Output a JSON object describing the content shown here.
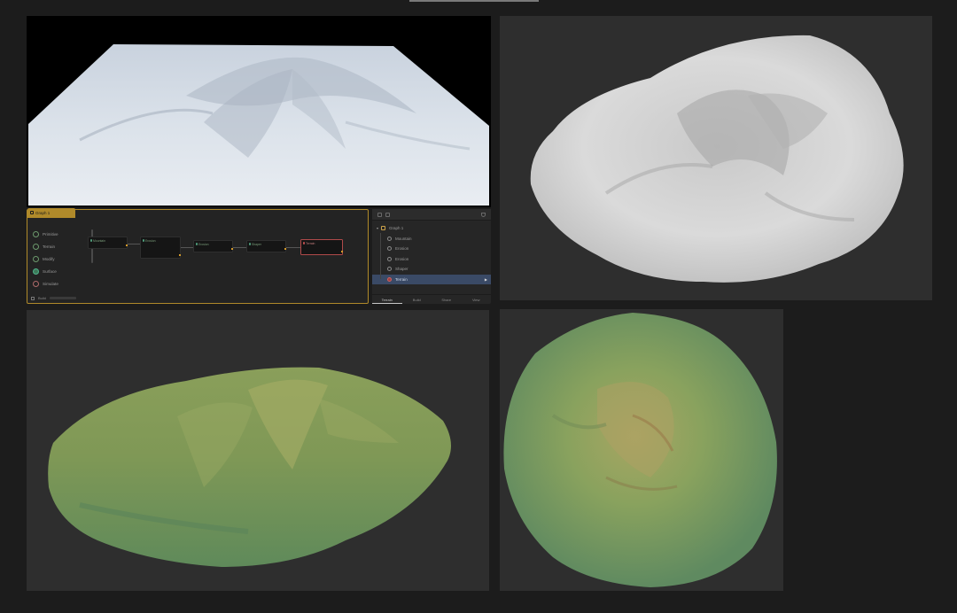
{
  "graph": {
    "tab_title": "Graph 1",
    "toolbox": [
      {
        "label": "Primitive",
        "icon": "primitive-icon"
      },
      {
        "label": "Terrain",
        "icon": "terrain-icon"
      },
      {
        "label": "Modify",
        "icon": "modify-icon"
      },
      {
        "label": "Surface",
        "icon": "surface-icon"
      },
      {
        "label": "Simulate",
        "icon": "simulate-icon"
      }
    ],
    "footer_label": "Build",
    "nodes": [
      {
        "title": "Mountain"
      },
      {
        "title": "Erosion"
      },
      {
        "title": "Erosion"
      },
      {
        "title": "Shaper"
      },
      {
        "title": "Terrain"
      }
    ]
  },
  "explorer": {
    "root": "Graph 1",
    "items": [
      {
        "label": "Mountain",
        "icon": "mountain-icon"
      },
      {
        "label": "Erosion",
        "icon": "erosion-icon"
      },
      {
        "label": "Erosion",
        "icon": "erosion-icon"
      },
      {
        "label": "Shaper",
        "icon": "shaper-icon"
      },
      {
        "label": "Terrain",
        "icon": "terrain-icon",
        "selected": true
      }
    ],
    "tabs": [
      "Terrain",
      "Build",
      "Share",
      "View"
    ],
    "active_tab": "Terrain"
  },
  "colors": {
    "accent": "#b08a2a",
    "selection": "#3a4a66",
    "viewport_bg": "#2e2e2e"
  }
}
